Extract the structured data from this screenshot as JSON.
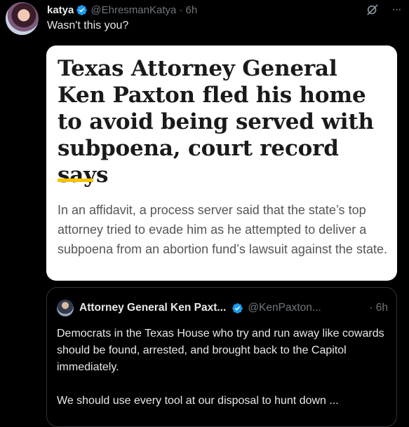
{
  "tweet": {
    "author": {
      "display_name": "katya",
      "handle": "@EhresmanKatya",
      "time": "· 6h",
      "verified": true
    },
    "text": "Wasn't this you?",
    "actions": [
      "grok-icon",
      "more-icon"
    ],
    "more_label": "···"
  },
  "article_card": {
    "headline": "Texas Attorney General Ken Paxton fled his home to avoid being served with subpoena, court record says",
    "summary": "In an affidavit, a process server said that the state’s top attorney tried to evade him as he attempted to deliver a subpoena from an abortion fund’s lawsuit against the state.",
    "accent_color": "#f7c300"
  },
  "quoted_tweet": {
    "display_name": "Attorney General Ken Paxt...",
    "handle": "@KenPaxton...",
    "time": "· 6h",
    "verified": true,
    "paragraphs": [
      "Democrats in the Texas House who try and run away like cowards should be found, arrested, and brought back to the Capitol immediately.",
      "We should use every tool at our disposal to hunt down ..."
    ]
  },
  "colors": {
    "background": "#000000",
    "text": "#e7e9ea",
    "muted": "#71767b",
    "verified_blue": "#1d9bf0",
    "border": "#2f3336"
  }
}
